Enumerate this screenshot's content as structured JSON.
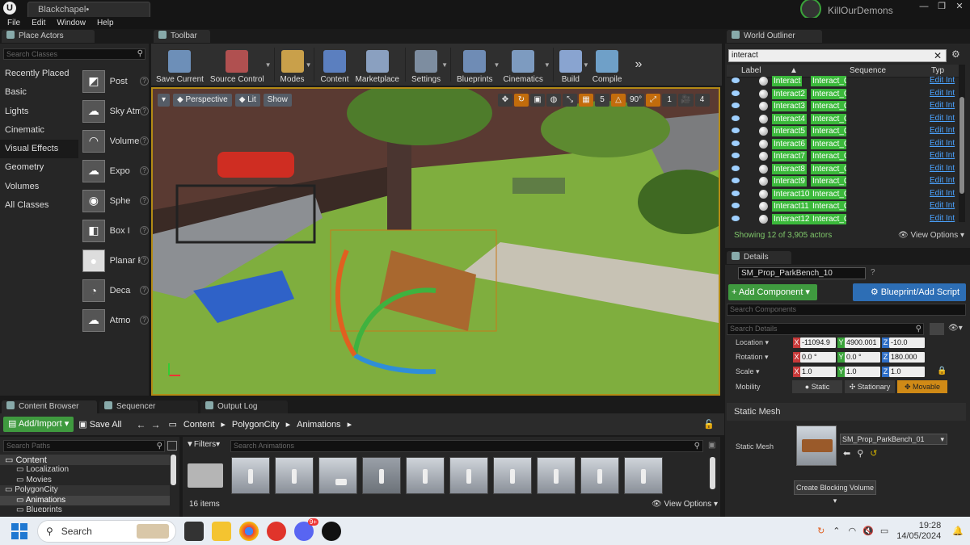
{
  "window": {
    "document_tab": "Blackchapel•",
    "project": "KillOurDemons"
  },
  "menu": [
    "File",
    "Edit",
    "Window",
    "Help"
  ],
  "place_actors": {
    "tab": "Place Actors",
    "search_placeholder": "Search Classes",
    "categories": [
      "Recently Placed",
      "Basic",
      "Lights",
      "Cinematic",
      "Visual Effects",
      "Geometry",
      "Volumes",
      "All Classes"
    ],
    "selected_category": "Visual Effects",
    "items": [
      "Post",
      "Sky Atm",
      "Volume",
      "Expo",
      "Sphe",
      "Box I",
      "Planar F",
      "Deca",
      "Atmo"
    ]
  },
  "toolbar": {
    "tab": "Toolbar",
    "buttons": [
      {
        "label": "Save Current",
        "color": "#6d8fb8"
      },
      {
        "label": "Source Control",
        "color": "#b05050"
      },
      {
        "label": "Modes",
        "color": "#c9a04a"
      },
      {
        "label": "Content",
        "color": "#5b7fbf"
      },
      {
        "label": "Marketplace",
        "color": "#8aa0c0"
      },
      {
        "label": "Settings",
        "color": "#7d8da0"
      },
      {
        "label": "Blueprints",
        "color": "#6f8cb5"
      },
      {
        "label": "Cinematics",
        "color": "#7d9bc0"
      },
      {
        "label": "Build",
        "color": "#89a4d0"
      },
      {
        "label": "Compile",
        "color": "#6fa0c8"
      }
    ]
  },
  "viewport": {
    "perspective": "Perspective",
    "lit": "Lit",
    "show": "Show",
    "grid_snap": "5",
    "rot_snap": "90°",
    "scale_snap": "1",
    "cam_speed": "4"
  },
  "outliner": {
    "tab": "World Outliner",
    "search_value": "interact",
    "columns": {
      "label": "Label",
      "sequence": "Sequence",
      "type": "Typ"
    },
    "rows": [
      {
        "label": "Interact",
        "seq": "Interact_C",
        "type": "Edit Int"
      },
      {
        "label": "Interact2",
        "seq": "Interact_C",
        "type": "Edit Int"
      },
      {
        "label": "Interact3",
        "seq": "Interact_C",
        "type": "Edit Int"
      },
      {
        "label": "Interact4",
        "seq": "Interact_C",
        "type": "Edit Int"
      },
      {
        "label": "Interact5",
        "seq": "Interact_C",
        "type": "Edit Int"
      },
      {
        "label": "Interact6",
        "seq": "Interact_C",
        "type": "Edit Int"
      },
      {
        "label": "Interact7",
        "seq": "Interact_C",
        "type": "Edit Int"
      },
      {
        "label": "Interact8",
        "seq": "Interact_C",
        "type": "Edit Int"
      },
      {
        "label": "Interact9",
        "seq": "Interact_C",
        "type": "Edit Int"
      },
      {
        "label": "Interact10",
        "seq": "Interact_C",
        "type": "Edit Int"
      },
      {
        "label": "Interact11",
        "seq": "Interact_C",
        "type": "Edit Int"
      },
      {
        "label": "Interact12",
        "seq": "Interact_C",
        "type": "Edit Int"
      }
    ],
    "status": "Showing 12 of 3,905 actors",
    "view_options": "View Options"
  },
  "details": {
    "tab": "Details",
    "actor_name": "SM_Prop_ParkBench_10",
    "add_component": "+ Add Component",
    "blueprint_script": "Blueprint/Add Script",
    "search_components": "Search Components",
    "search_details": "Search Details",
    "location": {
      "label": "Location",
      "x": "-11094.9",
      "y": "4900.001",
      "z": "-10.0"
    },
    "rotation": {
      "label": "Rotation",
      "x": "0.0 °",
      "y": "0.0 °",
      "z": "180.000"
    },
    "scale": {
      "label": "Scale",
      "x": "1.0",
      "y": "1.0",
      "z": "1.0"
    },
    "mobility": {
      "label": "Mobility",
      "static": "Static",
      "stationary": "Stationary",
      "movable": "Movable"
    },
    "static_mesh_section": "Static Mesh",
    "static_mesh_label": "Static Mesh",
    "static_mesh_value": "SM_Prop_ParkBench_01",
    "create_blocking": "Create Blocking Volume"
  },
  "content_browser": {
    "tabs": [
      "Content Browser",
      "Sequencer",
      "Output Log"
    ],
    "add_import": "Add/Import",
    "save_all": "Save All",
    "breadcrumb": [
      "Content",
      "PolygonCity",
      "Animations"
    ],
    "search_paths": "Search Paths",
    "filters": "Filters",
    "search_assets": "Search Animations",
    "tree": [
      {
        "label": "Content",
        "level": 0
      },
      {
        "label": "Localization",
        "level": 1
      },
      {
        "label": "Movies",
        "level": 1
      },
      {
        "label": "PolygonCity",
        "level": 0
      },
      {
        "label": "Animations",
        "level": 1
      },
      {
        "label": "Blueprints",
        "level": 1
      }
    ],
    "item_count": "16 items",
    "view_options": "View Options"
  },
  "taskbar": {
    "search": "Search",
    "time": "19:28",
    "date": "14/05/2024",
    "badge": "9+"
  }
}
